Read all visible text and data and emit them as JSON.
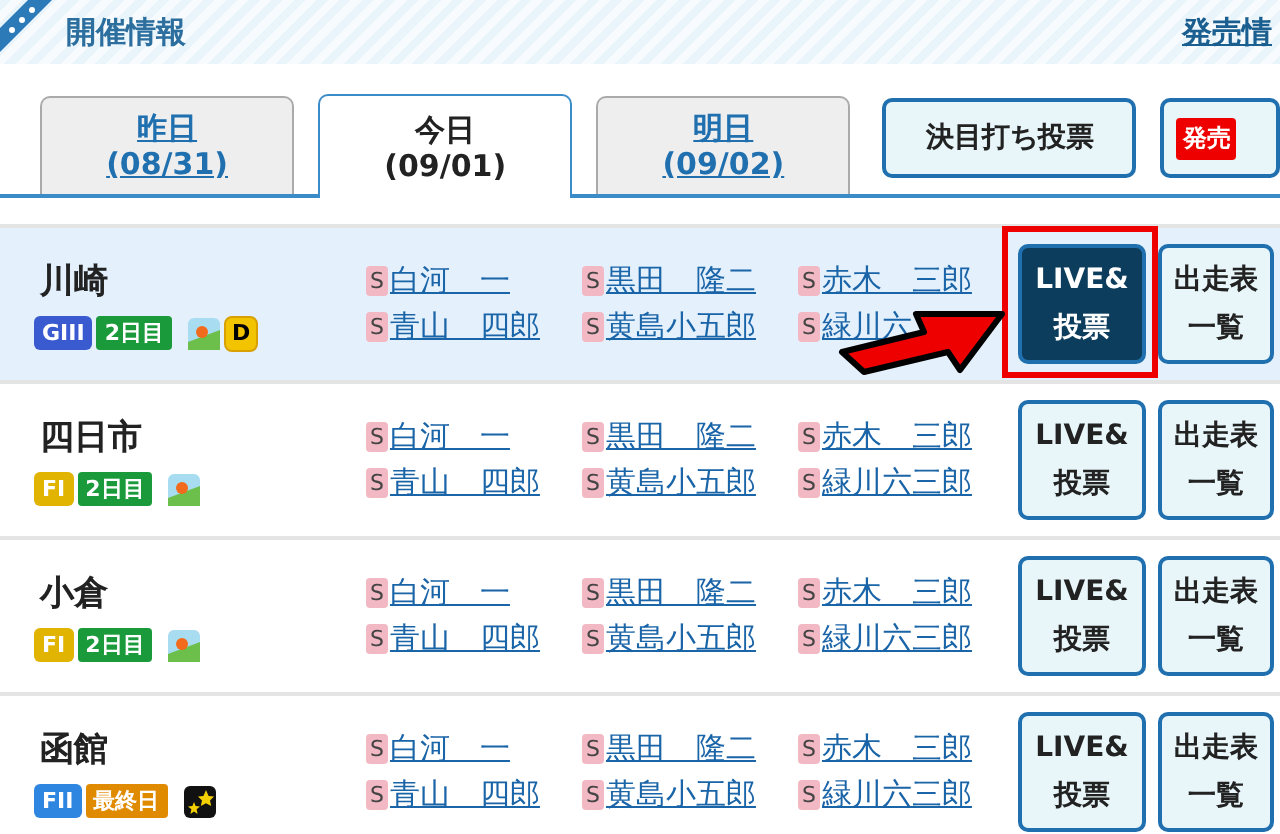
{
  "header": {
    "title": "開催情報",
    "link": "発売情"
  },
  "tabs": [
    {
      "label": "昨日",
      "date": "(08/31)",
      "selected": false
    },
    {
      "label": "今日",
      "date": "(09/01)",
      "selected": true
    },
    {
      "label": "明日",
      "date": "(09/02)",
      "selected": false
    }
  ],
  "actions": [
    {
      "kind": "plain",
      "label": "決目打ち投票"
    },
    {
      "kind": "badge",
      "label": "発売"
    }
  ],
  "races": [
    {
      "venue": "川崎",
      "selected": true,
      "grade": {
        "label": "GIII",
        "color": "#3a5bd0"
      },
      "day": {
        "label": "2日目",
        "color": "#1a9a3a"
      },
      "weather_icon": {
        "kind": "day"
      },
      "extra": "D",
      "players": [
        [
          {
            "mark": "S",
            "name": "白河　一"
          },
          {
            "mark": "S",
            "name": "青山　四郎"
          }
        ],
        [
          {
            "mark": "S",
            "name": "黒田　隆二"
          },
          {
            "mark": "S",
            "name": "黄島小五郎"
          }
        ],
        [
          {
            "mark": "S",
            "name": "赤木　三郎"
          },
          {
            "mark": "S",
            "name": "緑川六"
          }
        ]
      ],
      "live": [
        "LIVE&",
        "投票"
      ],
      "list": [
        "出走表",
        "一覧"
      ],
      "highlighted": true
    },
    {
      "venue": "四日市",
      "selected": false,
      "grade": {
        "label": "FI",
        "color": "#e0b400"
      },
      "day": {
        "label": "2日目",
        "color": "#1a9a3a"
      },
      "weather_icon": {
        "kind": "day"
      },
      "players": [
        [
          {
            "mark": "S",
            "name": "白河　一"
          },
          {
            "mark": "S",
            "name": "青山　四郎"
          }
        ],
        [
          {
            "mark": "S",
            "name": "黒田　隆二"
          },
          {
            "mark": "S",
            "name": "黄島小五郎"
          }
        ],
        [
          {
            "mark": "S",
            "name": "赤木　三郎"
          },
          {
            "mark": "S",
            "name": "緑川六三郎"
          }
        ]
      ],
      "live": [
        "LIVE&",
        "投票"
      ],
      "list": [
        "出走表",
        "一覧"
      ],
      "highlighted": false
    },
    {
      "venue": "小倉",
      "selected": false,
      "grade": {
        "label": "FI",
        "color": "#e0b400"
      },
      "day": {
        "label": "2日目",
        "color": "#1a9a3a"
      },
      "weather_icon": {
        "kind": "day"
      },
      "players": [
        [
          {
            "mark": "S",
            "name": "白河　一"
          },
          {
            "mark": "S",
            "name": "青山　四郎"
          }
        ],
        [
          {
            "mark": "S",
            "name": "黒田　隆二"
          },
          {
            "mark": "S",
            "name": "黄島小五郎"
          }
        ],
        [
          {
            "mark": "S",
            "name": "赤木　三郎"
          },
          {
            "mark": "S",
            "name": "緑川六三郎"
          }
        ]
      ],
      "live": [
        "LIVE&",
        "投票"
      ],
      "list": [
        "出走表",
        "一覧"
      ],
      "highlighted": false
    },
    {
      "venue": "函館",
      "selected": false,
      "grade": {
        "label": "FII",
        "color": "#2f86e0"
      },
      "day": {
        "label": "最終日",
        "color": "#e08a00"
      },
      "weather_icon": {
        "kind": "night"
      },
      "players": [
        [
          {
            "mark": "S",
            "name": "白河　一"
          },
          {
            "mark": "S",
            "name": "青山　四郎"
          }
        ],
        [
          {
            "mark": "S",
            "name": "黒田　隆二"
          },
          {
            "mark": "S",
            "name": "黄島小五郎"
          }
        ],
        [
          {
            "mark": "S",
            "name": "赤木　三郎"
          },
          {
            "mark": "S",
            "name": "緑川六三郎"
          }
        ]
      ],
      "live": [
        "LIVE&",
        "投票"
      ],
      "list": [
        "出走表",
        "一覧"
      ],
      "highlighted": false
    }
  ]
}
